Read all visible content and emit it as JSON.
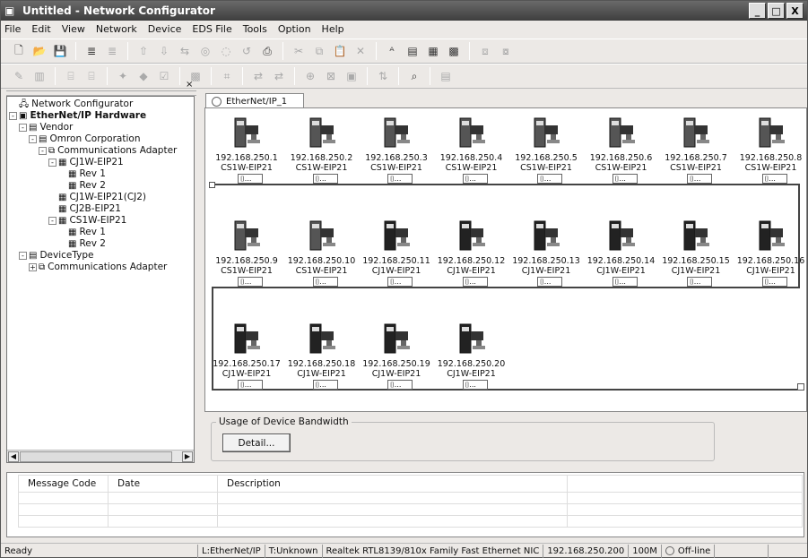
{
  "window": {
    "title": "Untitled - Network Configurator",
    "minimize": "_",
    "maximize": "□",
    "close": "X"
  },
  "menu": [
    "File",
    "Edit",
    "View",
    "Network",
    "Device",
    "EDS File",
    "Tools",
    "Option",
    "Help"
  ],
  "left_pane": {
    "close": "×",
    "tree": [
      {
        "label": "Network Configurator",
        "level": 0,
        "icon": "network-icon",
        "exp": ""
      },
      {
        "label": "EtherNet/IP Hardware",
        "level": 0,
        "icon": "hardware-icon",
        "exp": "-",
        "bold": true
      },
      {
        "label": "Vendor",
        "level": 1,
        "icon": "folder-icon",
        "exp": "-"
      },
      {
        "label": "Omron Corporation",
        "level": 2,
        "icon": "folder-icon",
        "exp": "-"
      },
      {
        "label": "Communications Adapter",
        "level": 3,
        "icon": "adapter-icon",
        "exp": "-"
      },
      {
        "label": "CJ1W-EIP21",
        "level": 4,
        "icon": "device-icon",
        "exp": "-"
      },
      {
        "label": "Rev 1",
        "level": 5,
        "icon": "device-icon",
        "exp": ""
      },
      {
        "label": "Rev 2",
        "level": 5,
        "icon": "device-icon",
        "exp": ""
      },
      {
        "label": "CJ1W-EIP21(CJ2)",
        "level": 4,
        "icon": "device-icon",
        "exp": ""
      },
      {
        "label": "CJ2B-EIP21",
        "level": 4,
        "icon": "device-icon",
        "exp": ""
      },
      {
        "label": "CS1W-EIP21",
        "level": 4,
        "icon": "device-icon",
        "exp": "-"
      },
      {
        "label": "Rev 1",
        "level": 5,
        "icon": "device-icon",
        "exp": ""
      },
      {
        "label": "Rev 2",
        "level": 5,
        "icon": "device-icon",
        "exp": ""
      },
      {
        "label": "DeviceType",
        "level": 1,
        "icon": "folder-icon",
        "exp": "-"
      },
      {
        "label": "Communications Adapter",
        "level": 2,
        "icon": "adapter-icon",
        "exp": "+"
      }
    ]
  },
  "network_tab": "EtherNet/IP_1",
  "devices": [
    {
      "ip": "192.168.250.1",
      "model": "CS1W-EIP21"
    },
    {
      "ip": "192.168.250.2",
      "model": "CS1W-EIP21"
    },
    {
      "ip": "192.168.250.3",
      "model": "CS1W-EIP21"
    },
    {
      "ip": "192.168.250.4",
      "model": "CS1W-EIP21"
    },
    {
      "ip": "192.168.250.5",
      "model": "CS1W-EIP21"
    },
    {
      "ip": "192.168.250.6",
      "model": "CS1W-EIP21"
    },
    {
      "ip": "192.168.250.7",
      "model": "CS1W-EIP21"
    },
    {
      "ip": "192.168.250.8",
      "model": "CS1W-EIP21"
    },
    {
      "ip": "192.168.250.9",
      "model": "CS1W-EIP21"
    },
    {
      "ip": "192.168.250.10",
      "model": "CS1W-EIP21"
    },
    {
      "ip": "192.168.250.11",
      "model": "CJ1W-EIP21"
    },
    {
      "ip": "192.168.250.12",
      "model": "CJ1W-EIP21"
    },
    {
      "ip": "192.168.250.13",
      "model": "CJ1W-EIP21"
    },
    {
      "ip": "192.168.250.14",
      "model": "CJ1W-EIP21"
    },
    {
      "ip": "192.168.250.15",
      "model": "CJ1W-EIP21"
    },
    {
      "ip": "192.168.250.16",
      "model": "CJ1W-EIP21"
    },
    {
      "ip": "192.168.250.17",
      "model": "CJ1W-EIP21"
    },
    {
      "ip": "192.168.250.18",
      "model": "CJ1W-EIP21"
    },
    {
      "ip": "192.168.250.19",
      "model": "CJ1W-EIP21"
    },
    {
      "ip": "192.168.250.20",
      "model": "CJ1W-EIP21"
    }
  ],
  "device_conn_label": "...",
  "bandwidth": {
    "group_label": "Usage of Device Bandwidth",
    "detail_button": "Detail..."
  },
  "messages": {
    "close": "×",
    "columns": [
      "Message Code",
      "Date",
      "Description"
    ],
    "rows": 4
  },
  "status": {
    "ready": "Ready",
    "port": "L:EtherNet/IP",
    "type": "T:Unknown",
    "nic": "Realtek RTL8139/810x Family Fast Ethernet NIC",
    "ip": "192.168.250.200",
    "speed": "100M",
    "mode": "Off-line"
  }
}
